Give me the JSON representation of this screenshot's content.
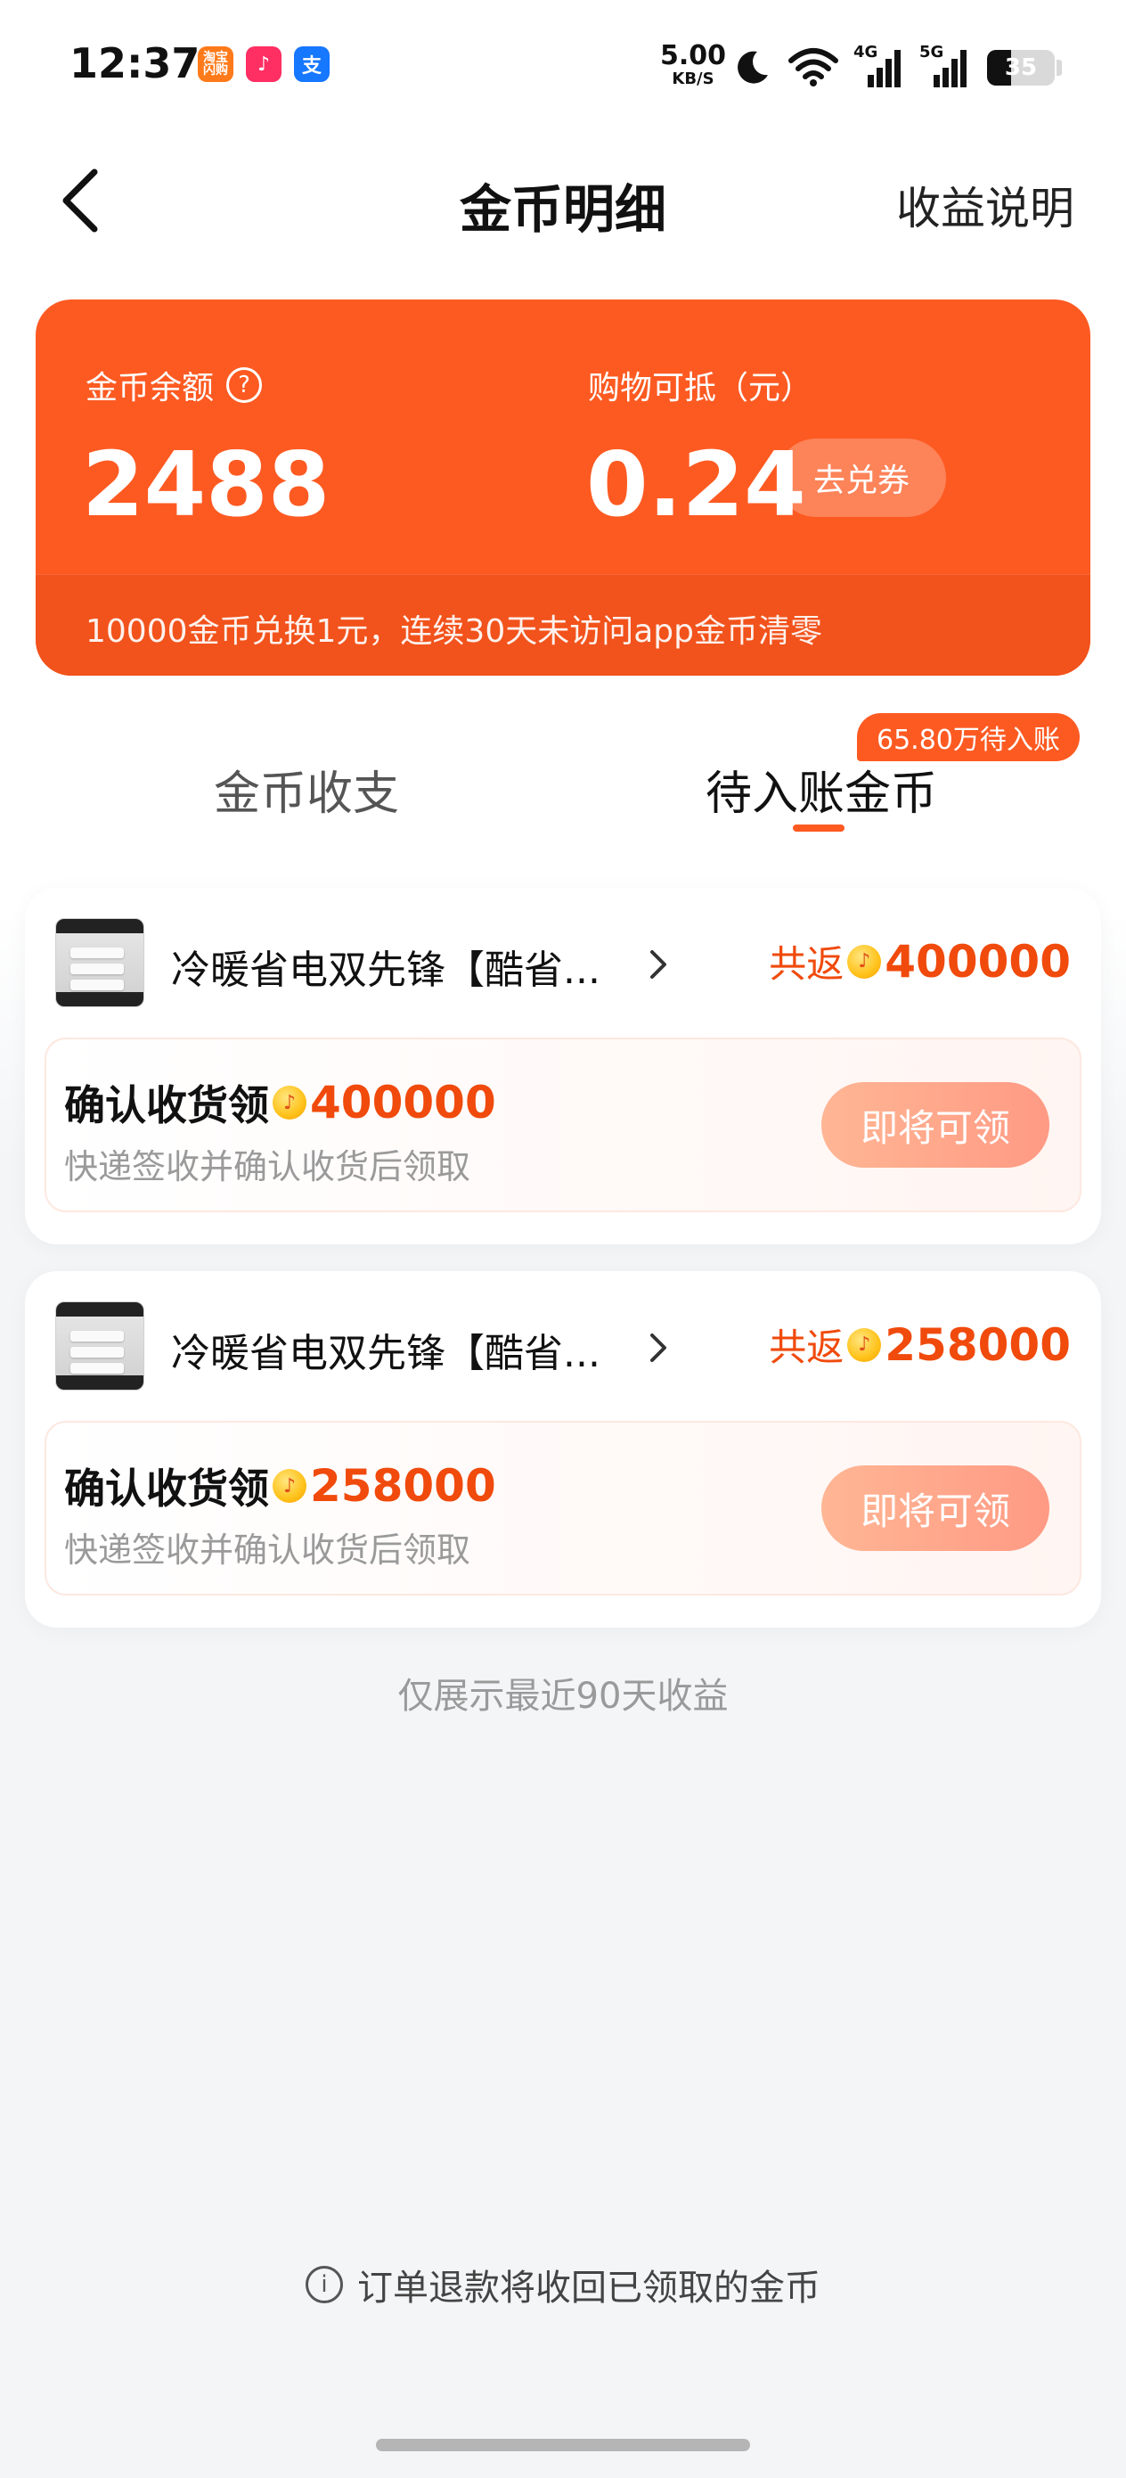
{
  "status_bar": {
    "time": "12:37",
    "apps": [
      {
        "name": "taobao-flash-icon",
        "label": "淘宝闪购",
        "color": "#ff7a1a"
      },
      {
        "name": "douyin-icon",
        "label": "♪",
        "color": "#ff2e63"
      },
      {
        "name": "alipay-icon",
        "label": "支",
        "color": "#1677ff"
      }
    ],
    "net_speed_value": "5.00",
    "net_speed_unit": "KB/S",
    "network_4g": "4G",
    "network_5g": "5G",
    "battery": "35"
  },
  "header": {
    "title": "金币明细",
    "link": "收益说明"
  },
  "balance": {
    "label": "金币余额",
    "value": "2488",
    "deduct_label": "购物可抵（元）",
    "deduct_value": "0.24",
    "redeem_button": "去兑券",
    "note": "10000金币兑换1元，连续30天未访问app金币清零"
  },
  "tabs": {
    "items": [
      {
        "label": "金币收支"
      },
      {
        "label": "待入账金币"
      }
    ],
    "badge": "65.80万待入账"
  },
  "orders": [
    {
      "product": "冷暖省电双先锋【酷省...",
      "return_label": "共返",
      "return_amount": "400000",
      "claim_title": "确认收货领",
      "claim_amount": "400000",
      "claim_sub": "快递签收并确认收货后领取",
      "claim_button": "即将可领"
    },
    {
      "product": "冷暖省电双先锋【酷省...",
      "return_label": "共返",
      "return_amount": "258000",
      "claim_title": "确认收货领",
      "claim_amount": "258000",
      "claim_sub": "快递签收并确认收货后领取",
      "claim_button": "即将可领"
    }
  ],
  "footer": {
    "recent_note": "仅展示最近90天收益",
    "refund_note": "订单退款将收回已领取的金币"
  },
  "colors": {
    "accent": "#fd5a22",
    "amount": "#f04a0c"
  }
}
